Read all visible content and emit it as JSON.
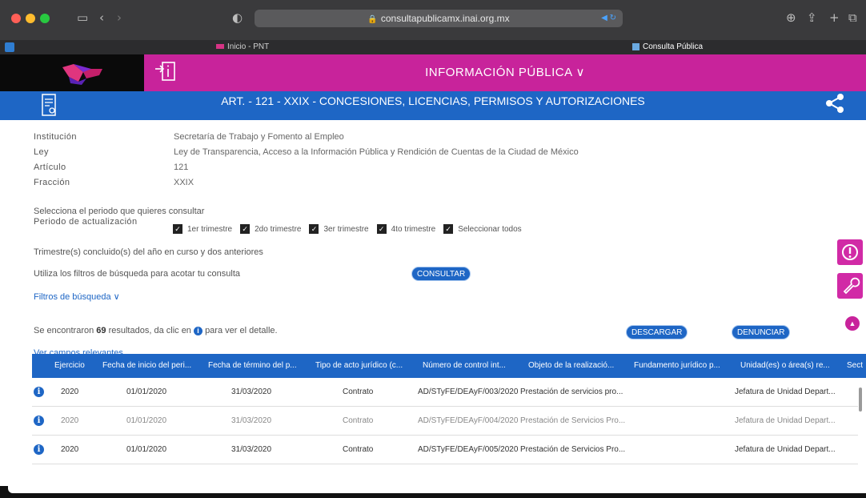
{
  "browser": {
    "url": "consultapublicamx.inai.org.mx",
    "tabs": [
      {
        "label": "Inicio - PNT"
      },
      {
        "label": "Consulta Pública"
      }
    ]
  },
  "header": {
    "title": "INFORMACIÓN PÚBLICA ∨",
    "band_title": "ART. - 121 - XXIX - CONCESIONES, LICENCIAS, PERMISOS Y AUTORIZACIONES"
  },
  "info": [
    {
      "key": "Institución",
      "value": "Secretaría de Trabajo y Fomento al Empleo"
    },
    {
      "key": "Ley",
      "value": "Ley de Transparencia, Acceso a la Información Pública y Rendición de Cuentas de la Ciudad de México"
    },
    {
      "key": "Artículo",
      "value": "121"
    },
    {
      "key": "Fracción",
      "value": "XXIX"
    }
  ],
  "period": {
    "prompt": "Selecciona el periodo que quieres consultar",
    "label": "Periodo de actualización",
    "options": [
      {
        "label": "1er trimestre",
        "checked": true
      },
      {
        "label": "2do trimestre",
        "checked": true
      },
      {
        "label": "3er trimestre",
        "checked": true
      },
      {
        "label": "4to trimestre",
        "checked": true
      },
      {
        "label": "Seleccionar todos",
        "checked": true
      }
    ],
    "note": "Trimestre(s) concluido(s) del año en curso y dos anteriores"
  },
  "filters": {
    "hint": "Utiliza los filtros de búsqueda para acotar tu consulta",
    "consult_button": "CONSULTAR",
    "toggle_label": "Filtros de búsqueda ∨"
  },
  "results": {
    "prefix": "Se encontraron",
    "count": "69",
    "suffix_1": "resultados, da clic en",
    "suffix_2": "para ver el detalle.",
    "download_button": "DESCARGAR",
    "report_button": "DENUNCIAR",
    "relevant_link": "Ver campos relevantes"
  },
  "table": {
    "headers": [
      "Ejercicio",
      "Fecha de inicio del peri...",
      "Fecha de término del p...",
      "Tipo de acto jurídico (c...",
      "Número de control int...",
      "Objeto de la realizació...",
      "Fundamento jurídico p...",
      "Unidad(es) o área(s) re...",
      "Sect"
    ],
    "rows": [
      [
        "2020",
        "01/01/2020",
        "31/03/2020",
        "Contrato",
        "AD/STyFE/DEAyF/003/2020",
        "Prestación de servicios pro...",
        "",
        "Jefatura de Unidad Depart..."
      ],
      [
        "2020",
        "01/01/2020",
        "31/03/2020",
        "Contrato",
        "AD/STyFE/DEAyF/004/2020",
        "Prestación de Servicios Pro...",
        "",
        "Jefatura de Unidad Depart..."
      ],
      [
        "2020",
        "01/01/2020",
        "31/03/2020",
        "Contrato",
        "AD/STyFE/DEAyF/005/2020",
        "Prestación de Servicios Pro...",
        "",
        "Jefatura de Unidad Depart..."
      ]
    ]
  },
  "colors": {
    "accent_blue": "#1e66c5",
    "accent_pink": "#c8239b"
  }
}
